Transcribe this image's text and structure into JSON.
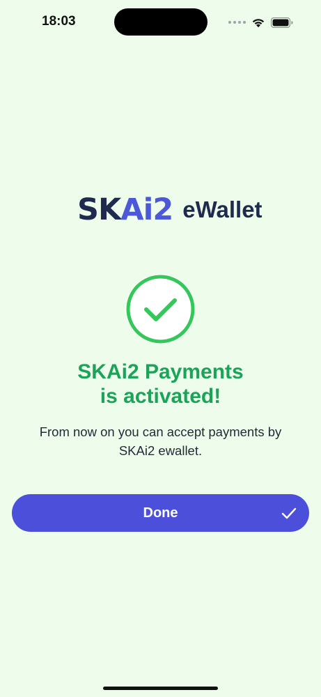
{
  "status_bar": {
    "time": "18:03",
    "icons": [
      "signal-dots-icon",
      "wifi-icon",
      "battery-icon"
    ]
  },
  "logo": {
    "mark_sk": "SK",
    "mark_ai": "Ai2",
    "text": "eWallet",
    "colors": {
      "dark": "#1E2A4E",
      "accent": "#4C58D8"
    }
  },
  "success": {
    "icon": "checkmark-circle-icon",
    "title_line1": "SKAi2 Payments",
    "title_line2": "is activated!",
    "message": "From now on you can accept payments by SKAi2 ewallet."
  },
  "done_button": {
    "label": "Done",
    "icon": "checkmark-icon"
  },
  "colors": {
    "background": "#EEFDEB",
    "success_green": "#1BA35A",
    "circle_green": "#34C759",
    "button": "#4C4FD9"
  }
}
